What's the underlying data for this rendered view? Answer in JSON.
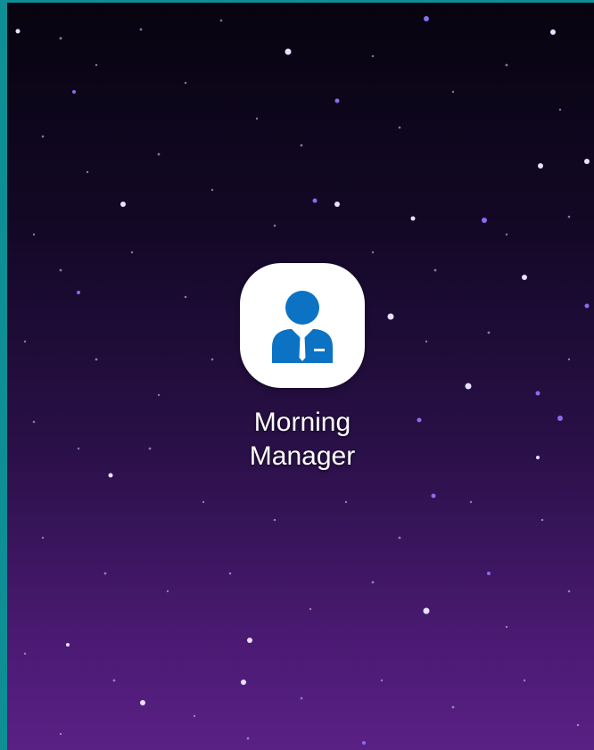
{
  "home_screen": {
    "apps": [
      {
        "label_line1": "Morning",
        "label_line2": "Manager",
        "icon": "businessman-icon",
        "icon_color": "#0b72c4"
      }
    ]
  },
  "colors": {
    "frame_accent": "#0e8f95",
    "wallpaper_top": "#07040f",
    "wallpaper_bottom": "#5a2085",
    "icon_background": "#ffffff"
  }
}
